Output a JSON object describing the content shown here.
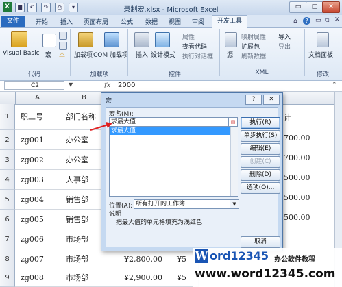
{
  "window": {
    "title": "录制宏.xlsx - Microsoft Excel",
    "controls": [
      "▭",
      "□",
      "✕"
    ]
  },
  "tabs": [
    "文件",
    "开始",
    "插入",
    "页面布局",
    "公式",
    "数据",
    "视图",
    "审阅",
    "开发工具"
  ],
  "ribbon": {
    "code": {
      "visual_basic": "Visual Basic",
      "macros": "宏",
      "label": "代码"
    },
    "addins": {
      "addins": "加载项",
      "com_addins": "COM 加载项",
      "label": "加载项"
    },
    "controls": {
      "insert": "插入",
      "design_mode": "设计模式",
      "properties": "属性",
      "view_code": "查看代码",
      "run_dialog": "执行对话框",
      "label": "控件"
    },
    "xml": {
      "source": "源",
      "map_properties": "映射属性",
      "expansion_packs": "扩展包",
      "refresh_data": "刷新数据",
      "import": "导入",
      "export": "导出",
      "label": "XML"
    },
    "modify": {
      "document_panel": "文档面板",
      "label": "修改"
    }
  },
  "formula_bar": {
    "name_box": "C2",
    "fx": "fx",
    "value": "2000"
  },
  "grid": {
    "columns": [
      "A",
      "B"
    ],
    "rows": [
      {
        "num": "1",
        "a": "职工号",
        "b": "部门名称"
      },
      {
        "num": "2",
        "a": "zg001",
        "b": "办公室"
      },
      {
        "num": "3",
        "a": "zg002",
        "b": "办公室"
      },
      {
        "num": "4",
        "a": "zg003",
        "b": "人事部"
      },
      {
        "num": "5",
        "a": "zg004",
        "b": "销售部"
      },
      {
        "num": "6",
        "a": "zg005",
        "b": "销售部"
      },
      {
        "num": "7",
        "a": "zg006",
        "b": "市场部"
      },
      {
        "num": "8",
        "a": "zg007",
        "b": "市场部",
        "c": "¥2,800.00",
        "d": "¥5"
      },
      {
        "num": "9",
        "a": "zg008",
        "b": "市场部",
        "c": "¥2,900.00",
        "d": "¥5"
      }
    ],
    "right_col_header": "计",
    "right_values": [
      "700.00",
      "700.00",
      "500.00",
      "500.00",
      "500.00"
    ]
  },
  "dialog": {
    "title": "宏",
    "title_buttons": [
      "?",
      "✕"
    ],
    "macro_name_label": "宏名(M):",
    "macro_name_value": "求最大值",
    "macro_list": [
      "求最大值"
    ],
    "buttons": [
      "执行(R)",
      "单步执行(S)",
      "编辑(E)",
      "创建(C)",
      "删除(D)",
      "选项(O)..."
    ],
    "location_label": "位置(A):",
    "location_value": "所有打开的工作簿",
    "description_label": "说明",
    "description_text": "把最大值的单元格填充为浅红色",
    "cancel": "取消"
  },
  "watermark": {
    "brand_w": "W",
    "brand_rest": "ord12345",
    "brand_cn": "办公软件教程",
    "url": "www.word12345.com"
  },
  "colors": {
    "accent": "#2a6bbf",
    "selection": "#3399ff",
    "arrow": "#e02020",
    "watermark_blue": "#1a55b4"
  }
}
